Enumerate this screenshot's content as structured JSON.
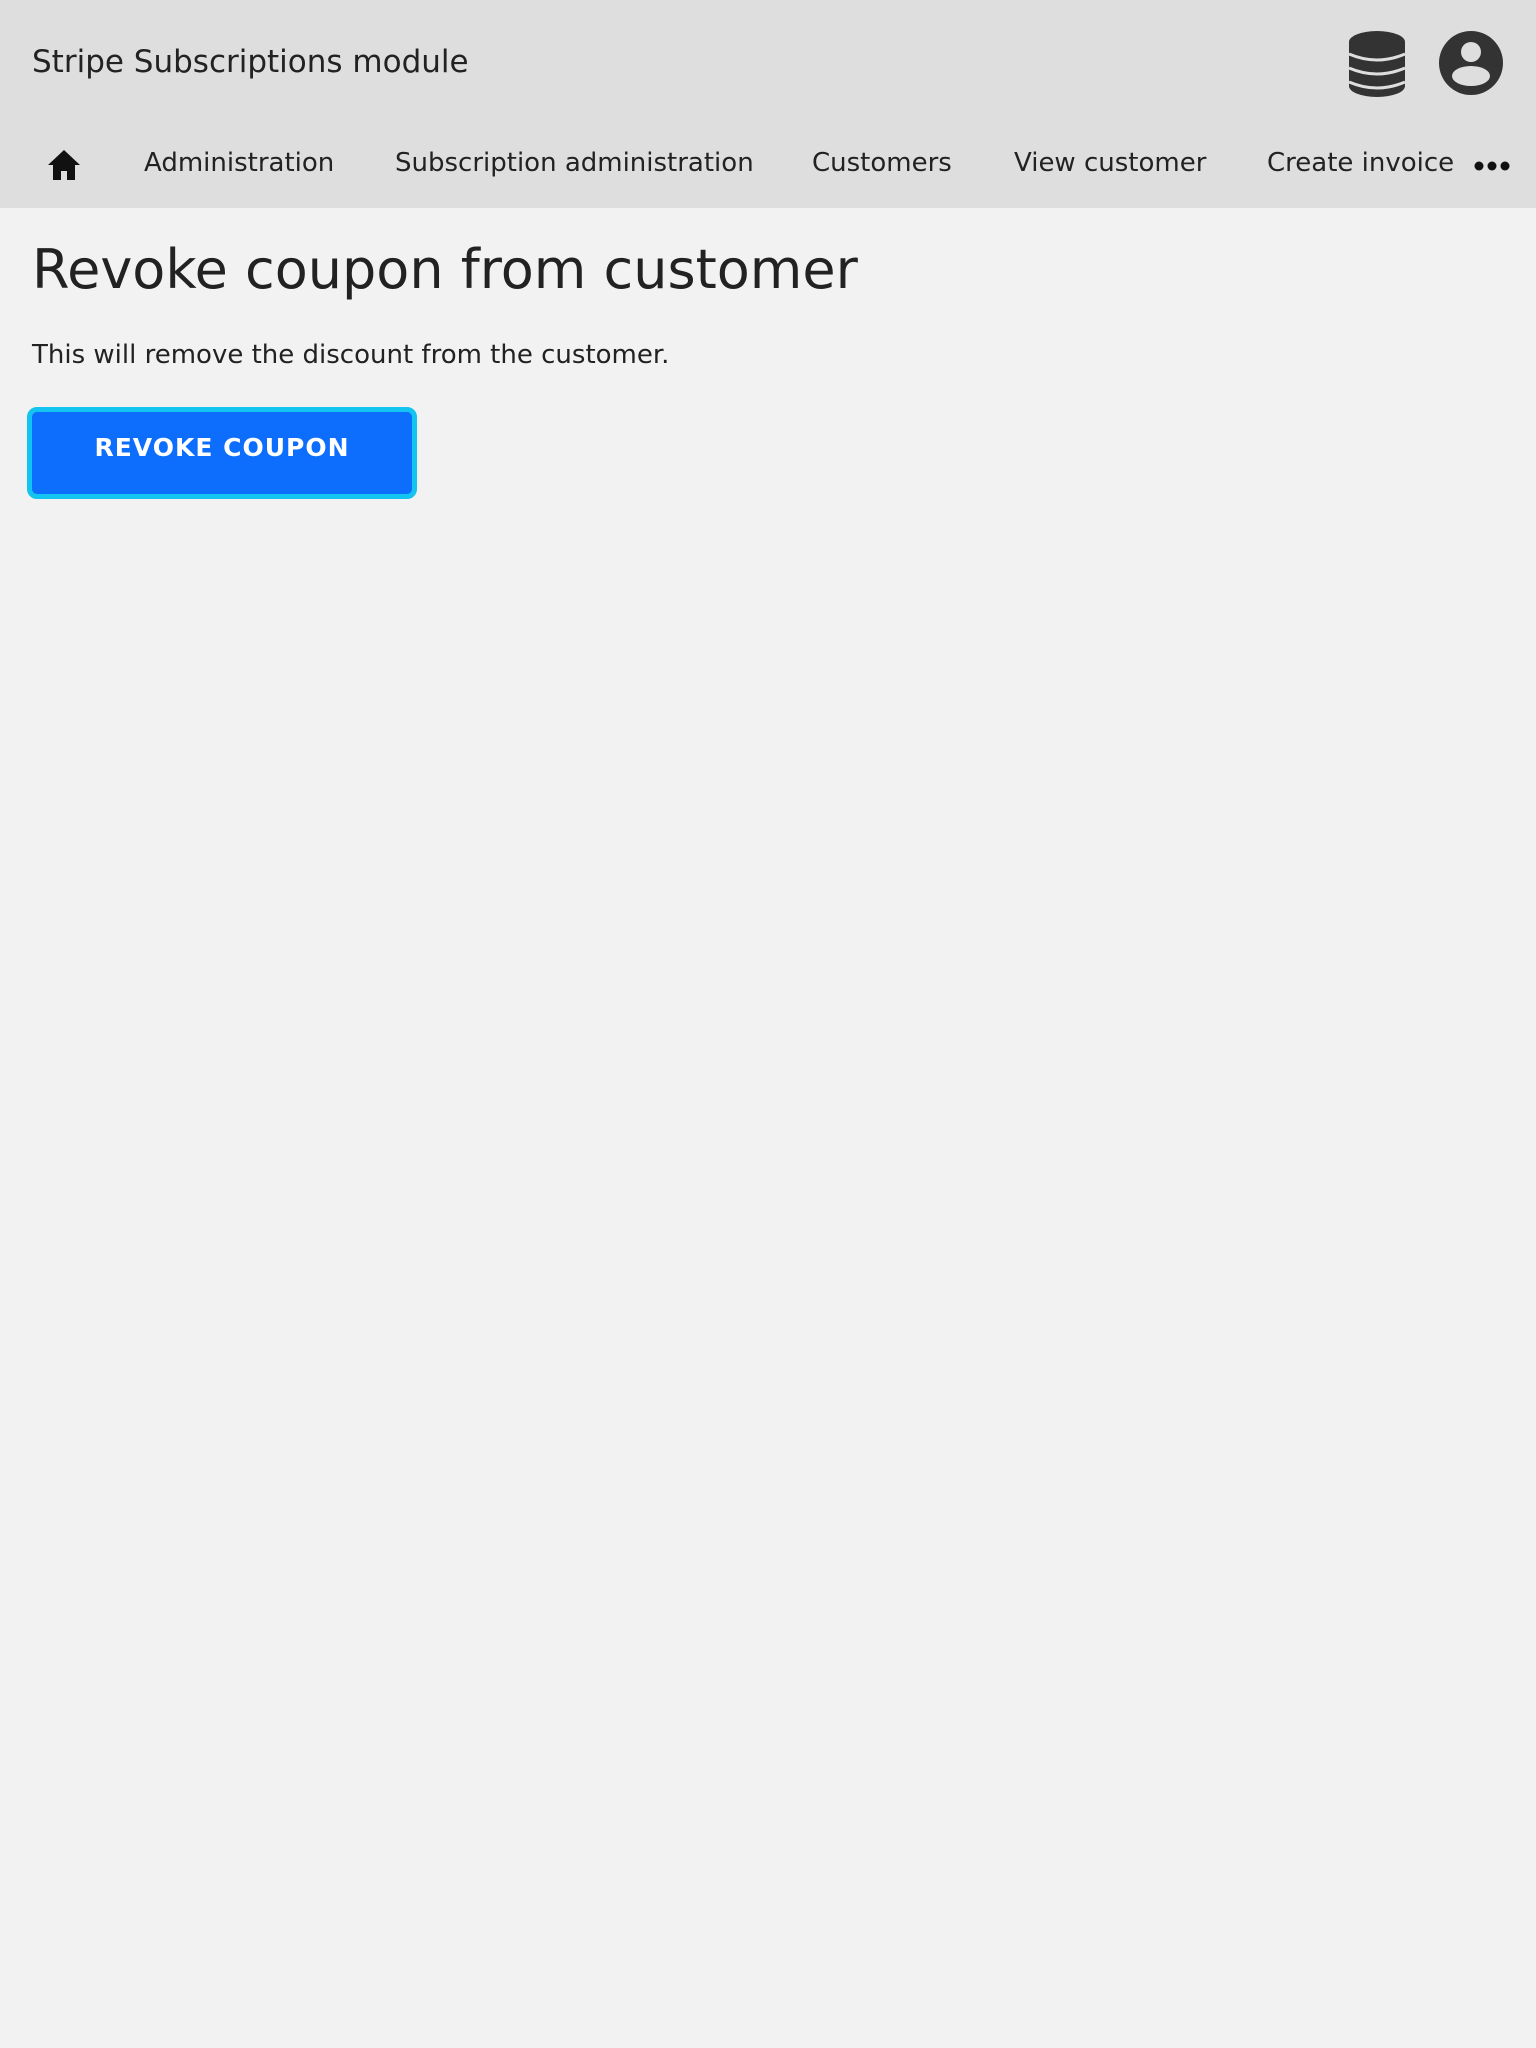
{
  "header": {
    "title": "Stripe Subscriptions module",
    "icons": [
      "database-icon",
      "user-circle-icon"
    ]
  },
  "nav": {
    "home_icon": "home-icon",
    "items": [
      {
        "label": "Administration"
      },
      {
        "label": "Subscription administration"
      },
      {
        "label": "Customers"
      },
      {
        "label": "View customer"
      },
      {
        "label": "Create invoice"
      }
    ],
    "more_icon": "more-horizontal-icon"
  },
  "main": {
    "title": "Revoke coupon from customer",
    "description": "This will remove the discount from the customer.",
    "revoke_button_label": "REVOKE COUPON"
  },
  "colors": {
    "header_bg": "#dedede",
    "page_bg": "#f2f2f2",
    "button_bg": "#0d6efd",
    "button_focus_ring": "#14c4f0",
    "icon_dark": "#333333"
  }
}
